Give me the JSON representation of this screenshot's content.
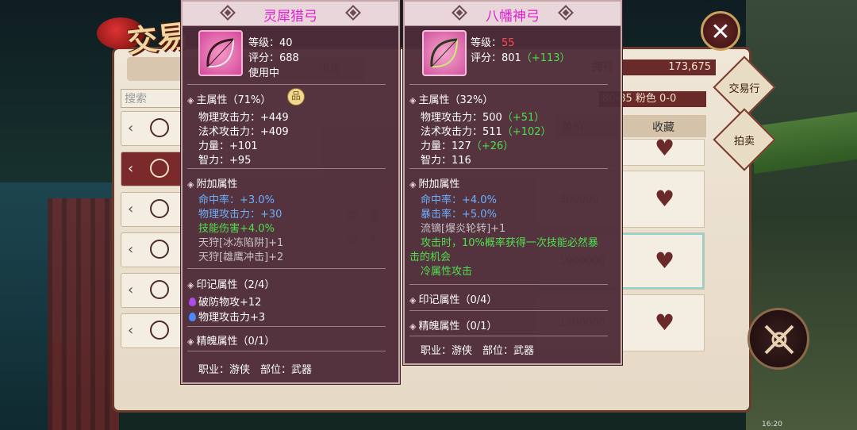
{
  "background": {
    "trade_title": "交易",
    "search_placeholder": "搜索",
    "tab_sell": "出售",
    "money_label": "拥有",
    "money_amount": "173,675",
    "filter_text": "80-85 粉色 0-0",
    "col_price": "单价",
    "col_favorite": "收藏",
    "quantity_label": "数　量",
    "unit_price_label": "单　价",
    "rows": [
      {
        "price": "300000"
      },
      {
        "price": "1000000"
      },
      {
        "price": "1500000"
      }
    ],
    "close_label": "✕",
    "side_buttons": {
      "trade_hall": "交易行",
      "auction": "拍卖"
    },
    "clock": "16:20"
  },
  "left_item": {
    "name": "灵犀猎弓",
    "level": "等级：40",
    "score": "评分：688",
    "status": "使用中",
    "main_attr_title": "主属性（71%）",
    "main_attrs": [
      "物理攻击力：+449",
      "法术攻击力：+409",
      "力量：+101",
      "智力：+95"
    ],
    "extra_attr_title": "附加属性",
    "extra_attrs": [
      {
        "text": "命中率：+3.0%",
        "color": "blue"
      },
      {
        "text": "物理攻击力：+30",
        "color": "blue"
      },
      {
        "text": "技能伤害+4.0%",
        "color": "green"
      },
      {
        "text": "天狩[冰冻陷阱]+1",
        "color": "gray"
      },
      {
        "text": "天狩[雄鹰冲击]+2",
        "color": "gray"
      }
    ],
    "imprint_title": "印记属性（2/4）",
    "imprints": [
      "破防物攻+12",
      "物理攻击力+3"
    ],
    "essence_title": "精魄属性（0/1）",
    "class_part": "职业：游侠　部位：武器"
  },
  "right_item": {
    "name": "八幡神弓",
    "level_label": "等级：",
    "level_value": "55",
    "score_label": "评分：801",
    "score_diff": "（+113）",
    "main_attr_title": "主属性（32%）",
    "main_attrs": [
      {
        "base": "物理攻击力：500",
        "diff": "（+51）"
      },
      {
        "base": "法术攻击力：511",
        "diff": "（+102）"
      },
      {
        "base": "力量：127",
        "diff": "（+26）"
      },
      {
        "base": "智力：116",
        "diff": ""
      }
    ],
    "extra_attr_title": "附加属性",
    "extra_attrs": [
      {
        "text": "命中率：+4.0%",
        "color": "blue"
      },
      {
        "text": "暴击率：+5.0%",
        "color": "blue"
      },
      {
        "text": "流镝[爆炎轮转]+1",
        "color": "gray"
      },
      {
        "text": "攻击时，10%概率获得一次技能必然暴",
        "color": "green"
      },
      {
        "text": "击的机会",
        "color": "green"
      },
      {
        "text": "冷属性攻击",
        "color": "green"
      }
    ],
    "imprint_title": "印记属性（0/4）",
    "essence_title": "精魄属性（0/1）",
    "class_part": "职业：游侠　部位：武器"
  },
  "colors": {
    "panel_bg": "#4e2c38",
    "title_magenta": "#e020d0",
    "stat_green": "#4de04d",
    "stat_blue": "#6ab0ff",
    "level_red": "#ff4a4a"
  }
}
